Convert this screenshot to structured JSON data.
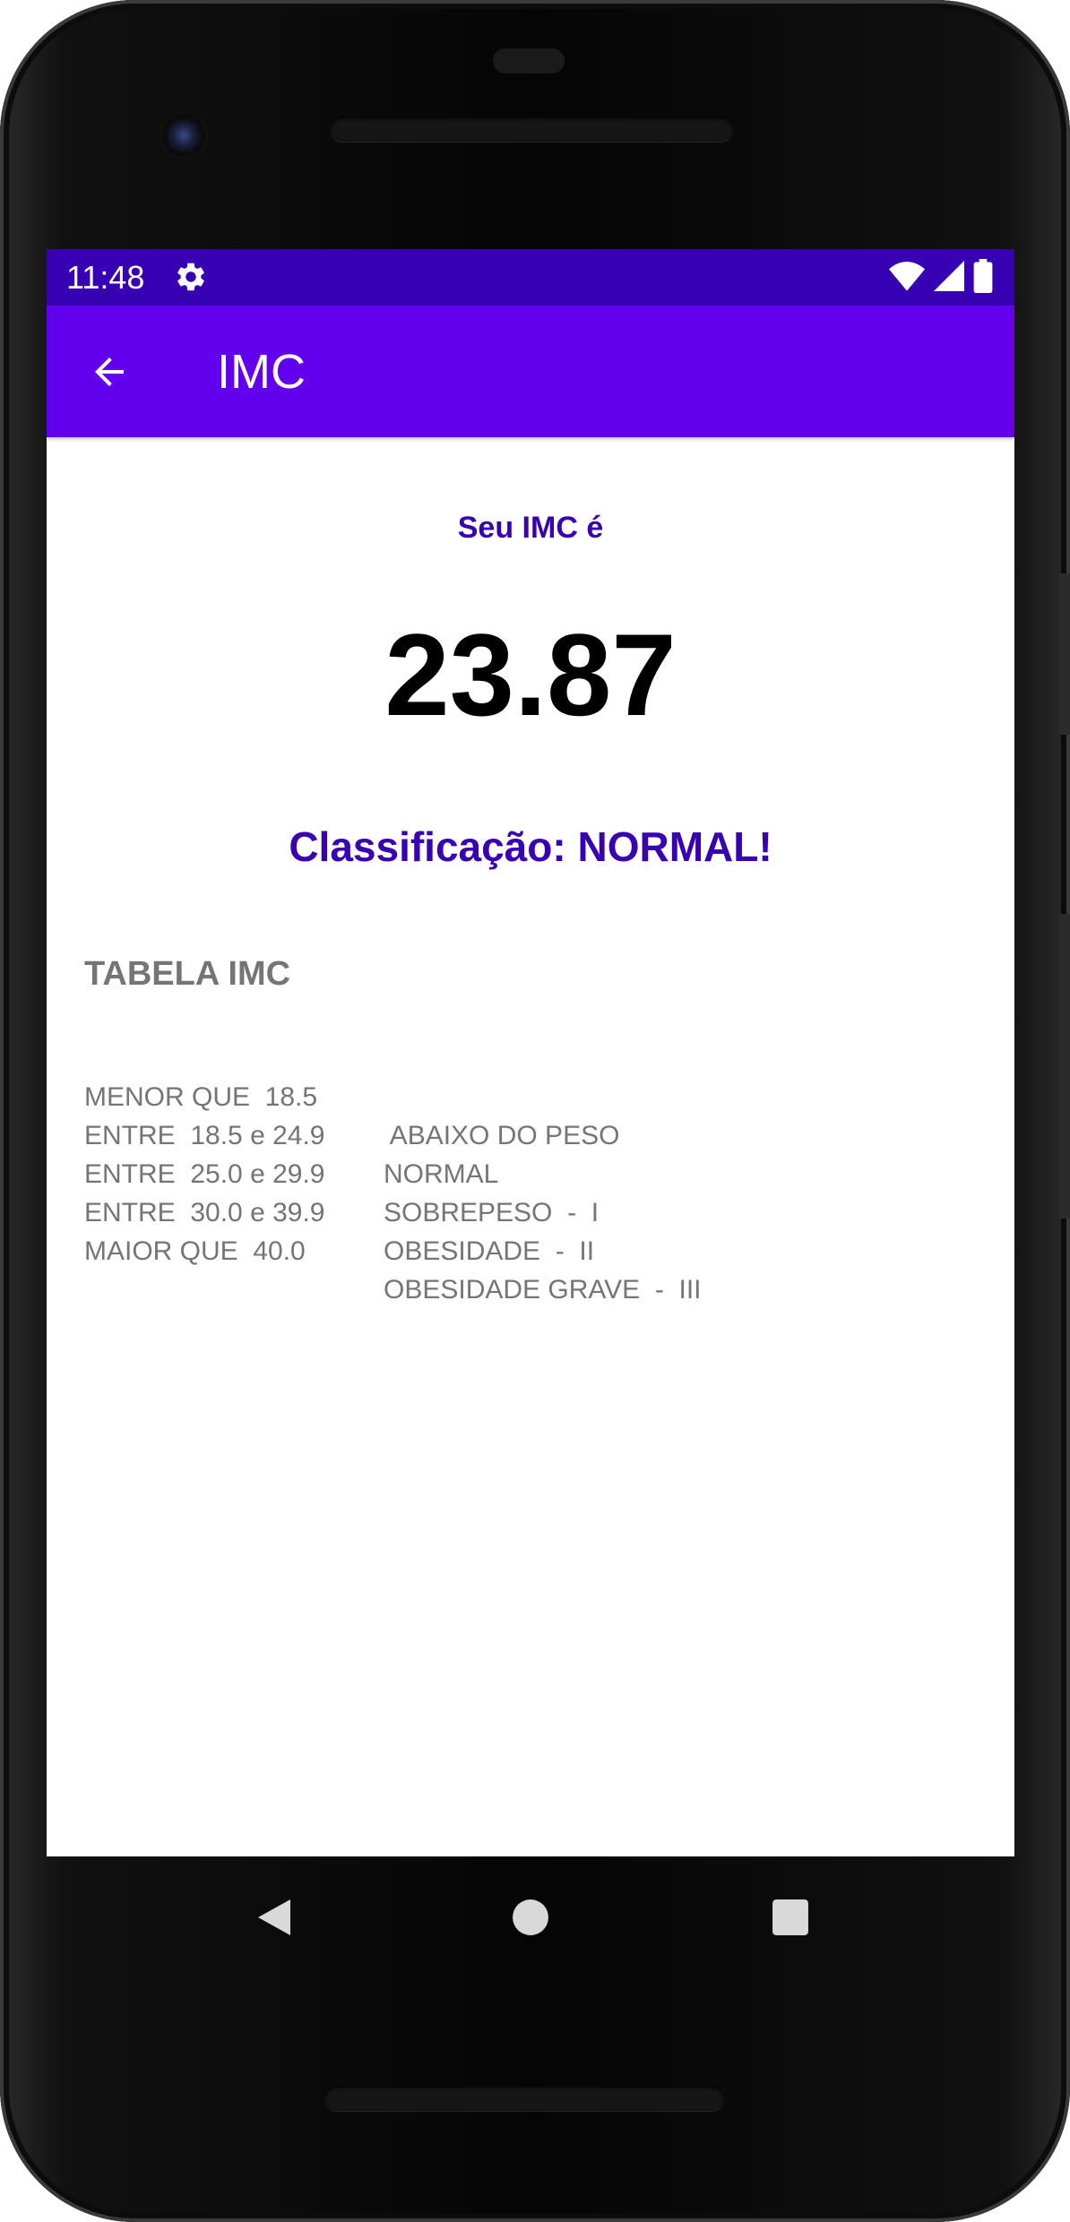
{
  "status_bar": {
    "time": "11:48",
    "icons": [
      "settings-icon",
      "wifi-icon",
      "signal-icon",
      "battery-icon"
    ]
  },
  "app_bar": {
    "title": "IMC",
    "back_icon": "arrow-back-icon"
  },
  "result": {
    "label": "Seu IMC é",
    "value": "23.87",
    "classification": "Classificação: NORMAL!"
  },
  "table": {
    "title": "TABELA IMC",
    "rows": [
      {
        "range": "MENOR QUE  18.5",
        "class": " ABAIXO DO PESO"
      },
      {
        "range": "ENTRE  18.5 e 24.9",
        "class": "NORMAL"
      },
      {
        "range": "ENTRE  25.0 e 29.9",
        "class": "SOBREPESO  -  I"
      },
      {
        "range": "ENTRE  30.0 e 39.9",
        "class": "OBESIDADE  -  II"
      },
      {
        "range": "MAIOR QUE  40.0",
        "class": "OBESIDADE GRAVE  -  III"
      }
    ]
  },
  "nav_bar": {
    "icons": [
      "back-triangle-icon",
      "home-circle-icon",
      "recents-square-icon"
    ]
  },
  "colors": {
    "status_bar": "#3700b3",
    "app_bar": "#6200ee",
    "accent_text": "#3700b3",
    "table_text": "#757575"
  }
}
